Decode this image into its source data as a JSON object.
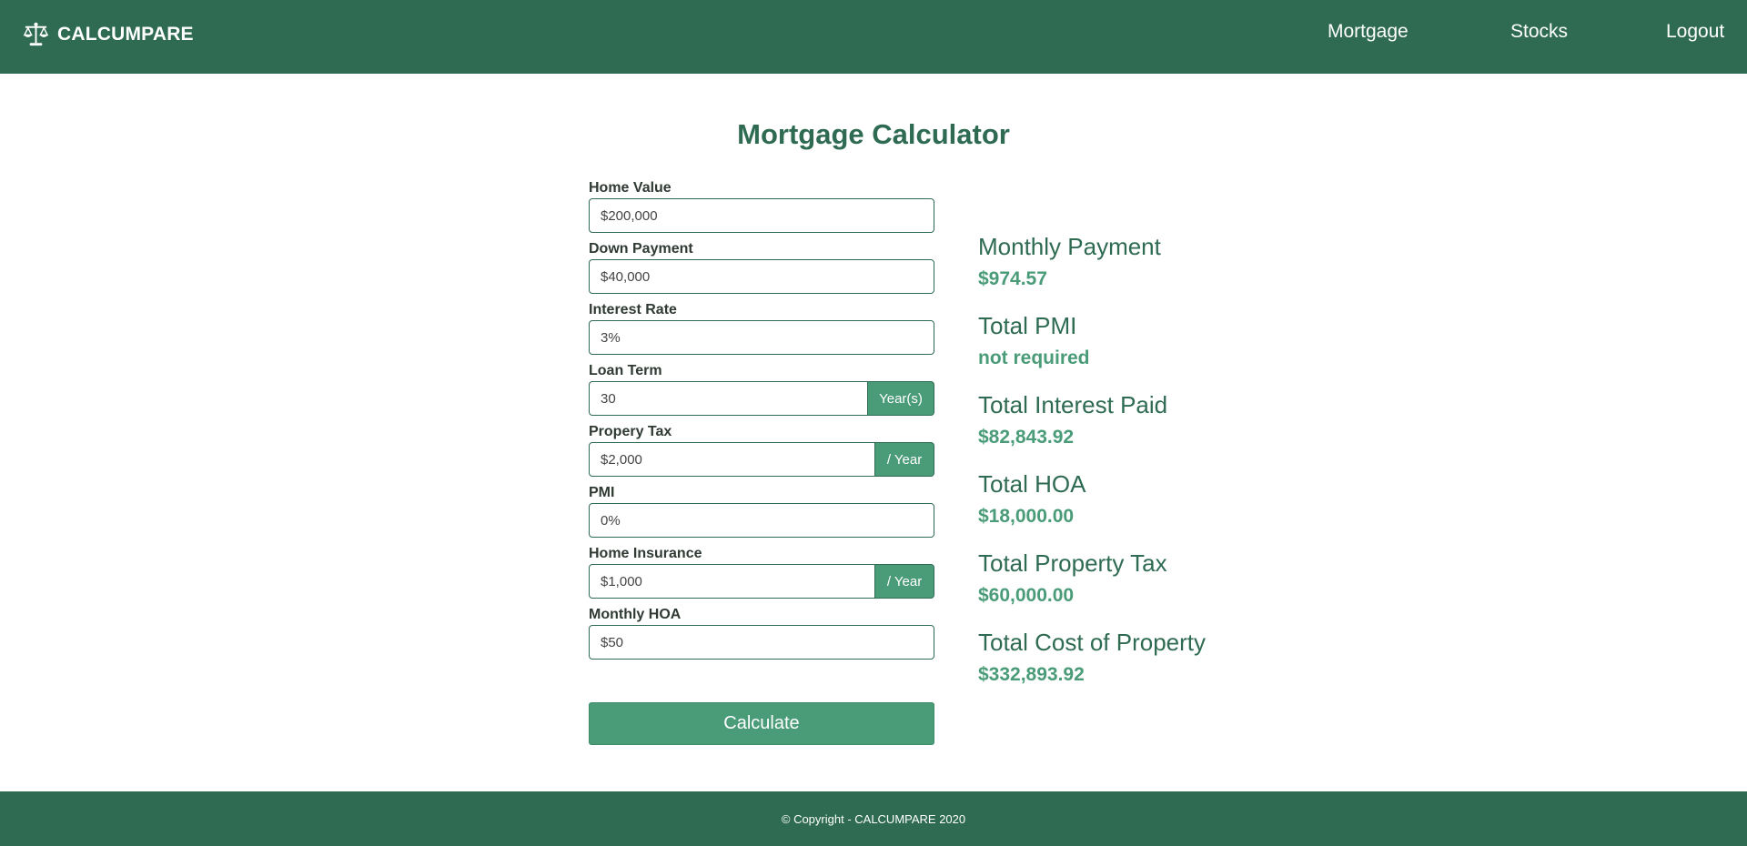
{
  "nav": {
    "brand": "CALCUMPARE",
    "links": [
      "Mortgage",
      "Stocks",
      "Logout"
    ]
  },
  "page": {
    "title": "Mortgage Calculator"
  },
  "form": {
    "fields": [
      {
        "label": "Home Value",
        "value": "$200,000"
      },
      {
        "label": "Down Payment",
        "value": "$40,000"
      },
      {
        "label": "Interest Rate",
        "value": "3%"
      },
      {
        "label": "Loan Term",
        "value": "30",
        "addon": "Year(s)"
      },
      {
        "label": "Propery Tax",
        "value": "$2,000",
        "addon": "/ Year"
      },
      {
        "label": "PMI",
        "value": "0%"
      },
      {
        "label": "Home Insurance",
        "value": "$1,000",
        "addon": "/ Year"
      },
      {
        "label": "Monthly HOA",
        "value": "$50"
      }
    ],
    "submit_label": "Calculate"
  },
  "results": [
    {
      "title": "Monthly Payment",
      "value": "$974.57"
    },
    {
      "title": "Total PMI",
      "value": "not required"
    },
    {
      "title": "Total Interest Paid",
      "value": "$82,843.92"
    },
    {
      "title": "Total HOA",
      "value": "$18,000.00"
    },
    {
      "title": "Total Property Tax",
      "value": "$60,000.00"
    },
    {
      "title": "Total Cost of Property",
      "value": "$332,893.92"
    }
  ],
  "footer": {
    "text": "© Copyright - CALCUMPARE 2020"
  },
  "colors": {
    "primary": "#2e6b52",
    "accent": "#4a9b78",
    "background": "#ffffff"
  }
}
